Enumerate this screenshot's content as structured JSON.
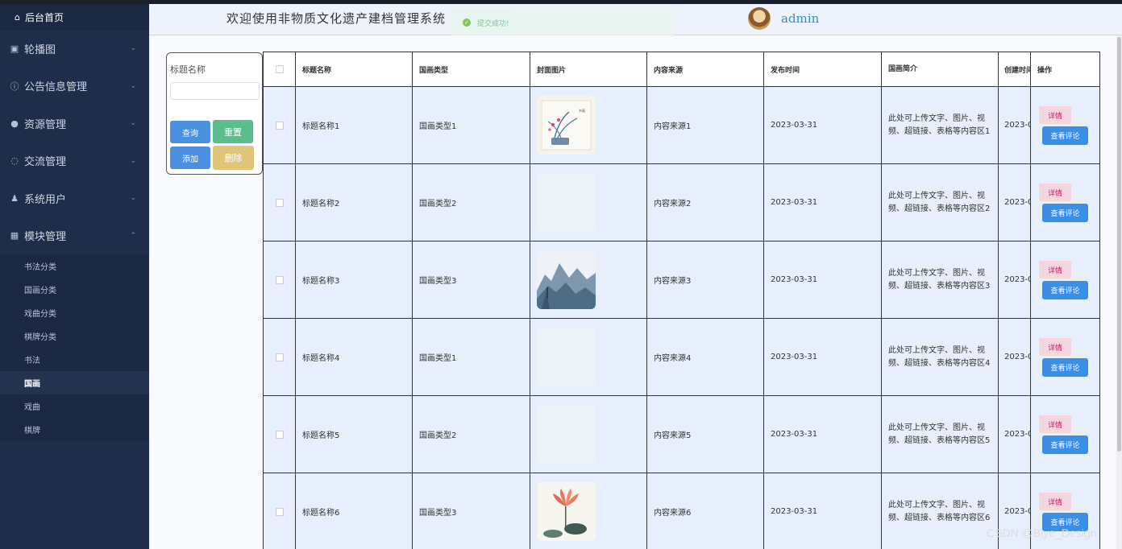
{
  "sidebar": {
    "home": "后台首页",
    "menus": [
      {
        "label": "轮播图",
        "icon": "image-icon"
      },
      {
        "label": "公告信息管理",
        "icon": "info-icon"
      },
      {
        "label": "资源管理",
        "icon": "location-icon"
      },
      {
        "label": "交流管理",
        "icon": "chat-icon"
      },
      {
        "label": "系统用户",
        "icon": "user-icon"
      },
      {
        "label": "模块管理",
        "icon": "grid-icon"
      }
    ],
    "submenus": [
      "书法分类",
      "国画分类",
      "戏曲分类",
      "棋牌分类",
      "书法",
      "国画",
      "戏曲",
      "棋牌"
    ],
    "active_submenu": "国画"
  },
  "header": {
    "welcome": "欢迎使用非物质文化遗产建档管理系统",
    "toast": "提交成功!",
    "username": "admin"
  },
  "search": {
    "label": "标题名称",
    "placeholder": "",
    "query": "查询",
    "reset": "重置",
    "add": "添加",
    "delete": "删除"
  },
  "table": {
    "columns": [
      "标题名称",
      "国画类型",
      "封面图片",
      "内容来源",
      "发布时间",
      "国画简介",
      "创建时间",
      "操作"
    ],
    "rows": [
      {
        "title": "标题名称1",
        "type": "国画类型1",
        "source": "内容来源1",
        "date": "2023-03-31",
        "intro": "此处可上传文字、图片、视频、超链接、表格等内容区1",
        "created": "2023-0",
        "image": "orchid"
      },
      {
        "title": "标题名称2",
        "type": "国画类型2",
        "source": "内容来源2",
        "date": "2023-03-31",
        "intro": "此处可上传文字、图片、视频、超链接、表格等内容区2",
        "created": "2023-0",
        "image": "none"
      },
      {
        "title": "标题名称3",
        "type": "国画类型3",
        "source": "内容来源3",
        "date": "2023-03-31",
        "intro": "此处可上传文字、图片、视频、超链接、表格等内容区3",
        "created": "2023-0",
        "image": "landscape"
      },
      {
        "title": "标题名称4",
        "type": "国画类型1",
        "source": "内容来源4",
        "date": "2023-03-31",
        "intro": "此处可上传文字、图片、视频、超链接、表格等内容区4",
        "created": "2023-0",
        "image": "none"
      },
      {
        "title": "标题名称5",
        "type": "国画类型2",
        "source": "内容来源5",
        "date": "2023-03-31",
        "intro": "此处可上传文字、图片、视频、超链接、表格等内容区5",
        "created": "2023-0",
        "image": "none"
      },
      {
        "title": "标题名称6",
        "type": "国画类型3",
        "source": "内容来源6",
        "date": "2023-03-31",
        "intro": "此处可上传文字、图片、视频、超链接、表格等内容区6",
        "created": "2023-0",
        "image": "lotus"
      }
    ],
    "detail_label": "详情",
    "comment_label": "查看评论"
  },
  "watermark": "CSDN @Biye_Design",
  "colors": {
    "sidebar_bg": "#1e2d4a",
    "primary": "#4a8fe0",
    "success": "#5bbd8c",
    "warning": "#e0c47a",
    "row_bg": "#e6effb"
  }
}
